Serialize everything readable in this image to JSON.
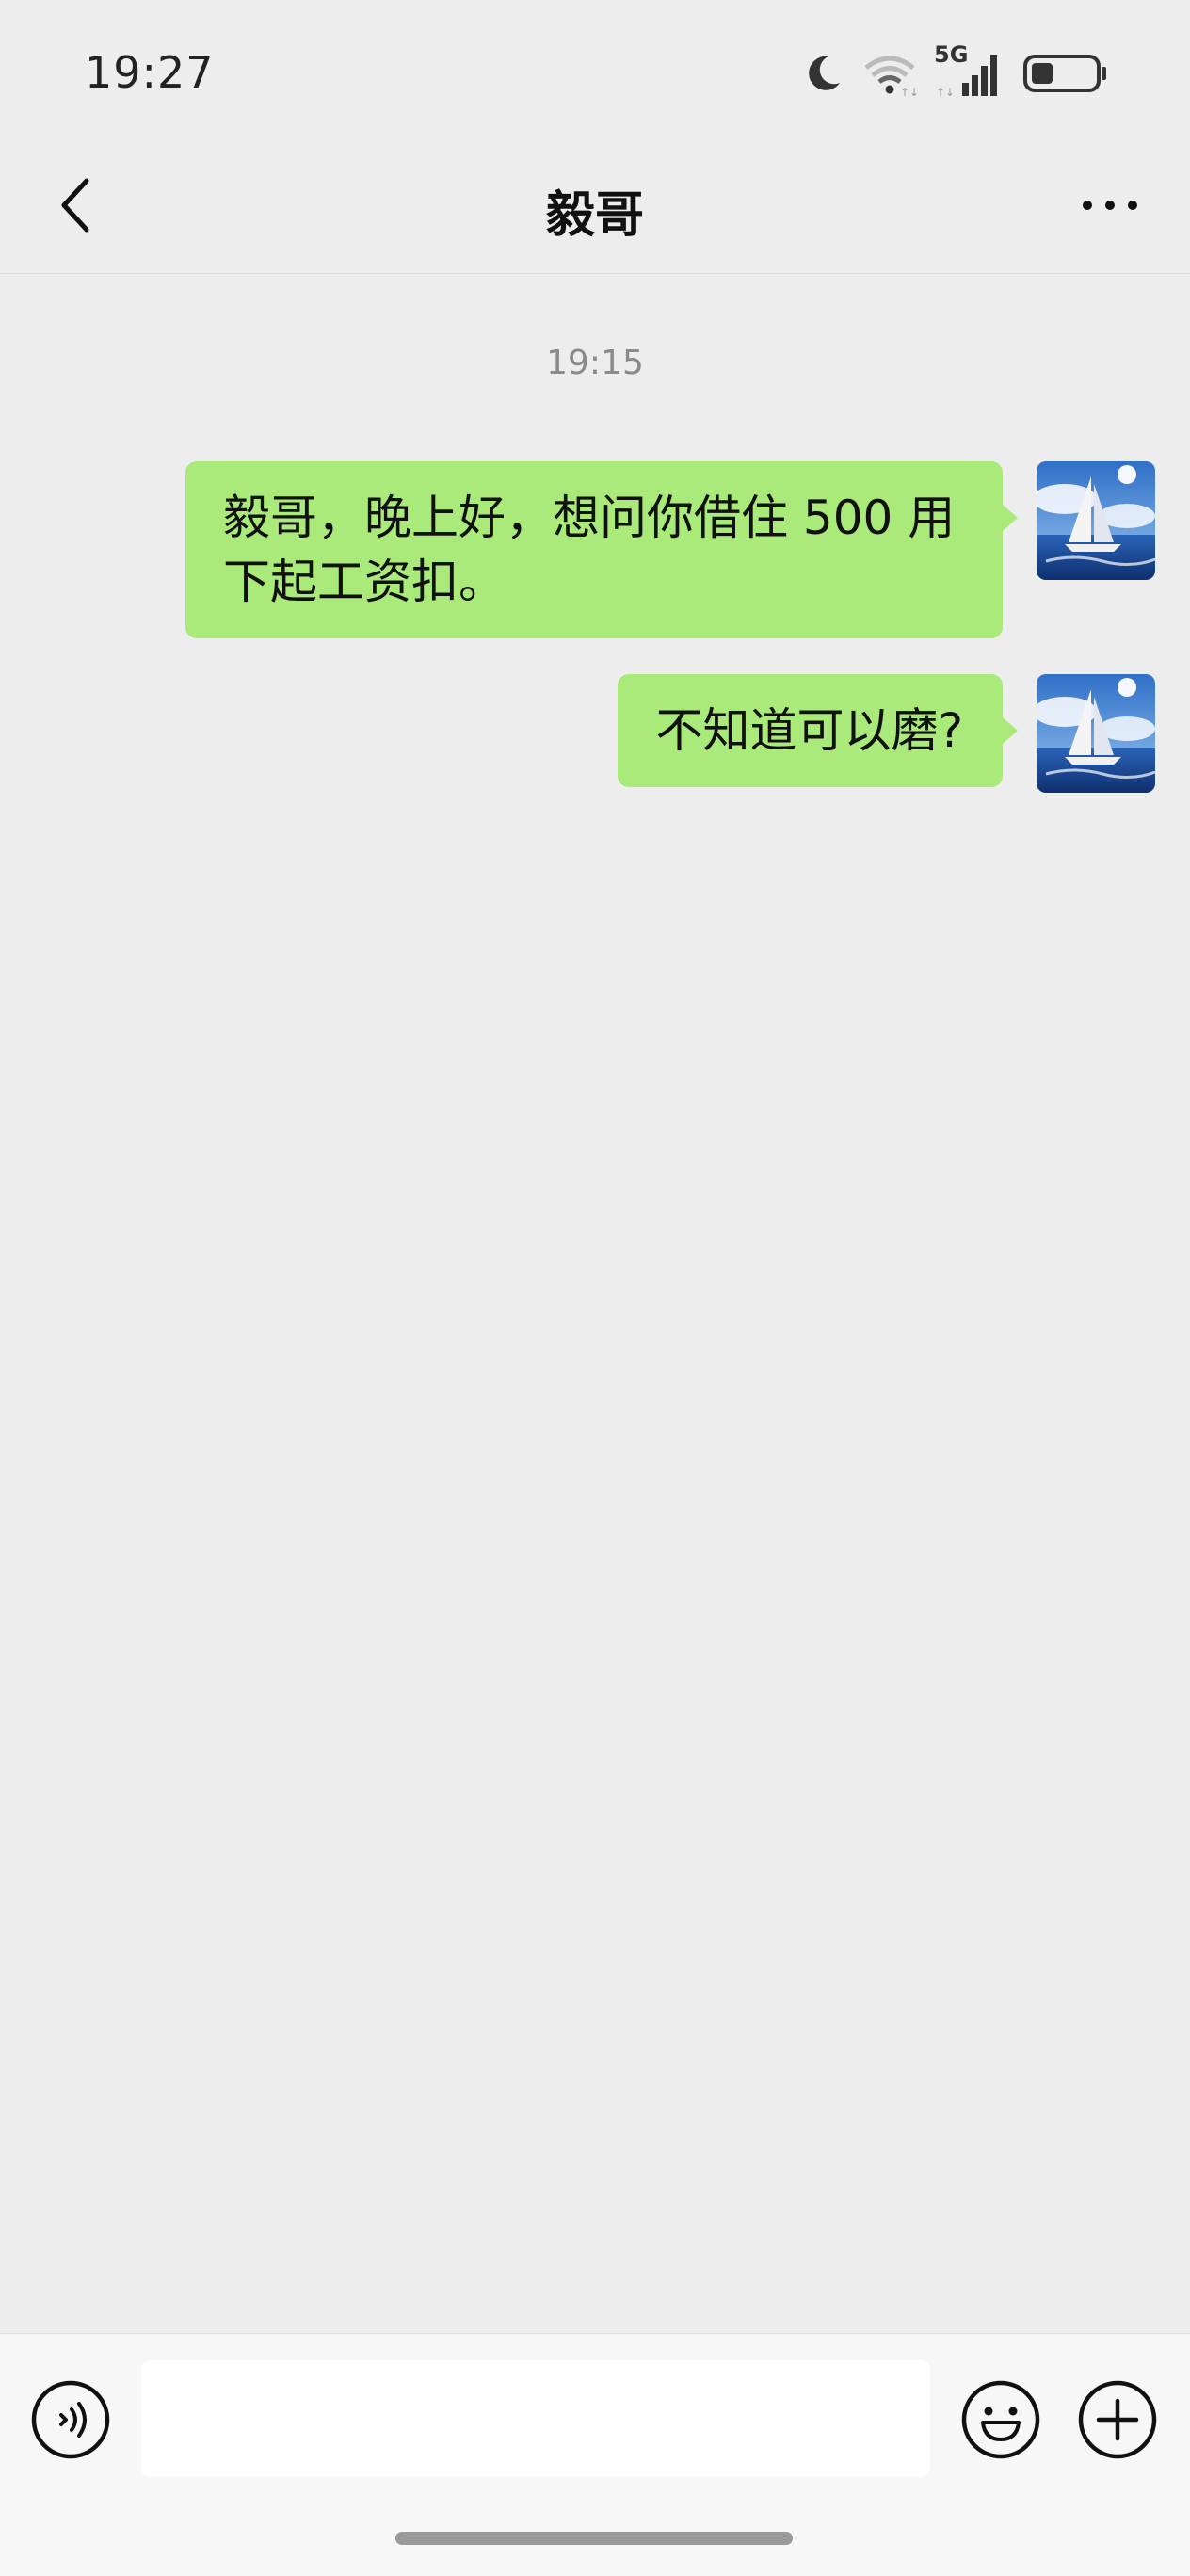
{
  "status_bar": {
    "time": "19:27",
    "network_label": "5G",
    "icons": [
      "moon-icon",
      "wifi-icon",
      "cellular-signal-icon",
      "battery-icon"
    ]
  },
  "header": {
    "title": "毅哥",
    "back_icon": "chevron-left-icon",
    "more_icon": "more-dots-icon"
  },
  "chat": {
    "timestamp": "19:15",
    "messages": [
      {
        "sender": "me",
        "text": "毅哥，晚上好，想问你借住 500 用下起工资扣。"
      },
      {
        "sender": "me",
        "text": "不知道可以磨?"
      }
    ]
  },
  "input_bar": {
    "value": "",
    "placeholder": "",
    "icons": [
      "voice-icon",
      "emoji-icon",
      "plus-icon"
    ]
  },
  "colors": {
    "background": "#ededed",
    "bubble_sent": "#a9ea7a",
    "input_bar": "#f7f7f7"
  }
}
